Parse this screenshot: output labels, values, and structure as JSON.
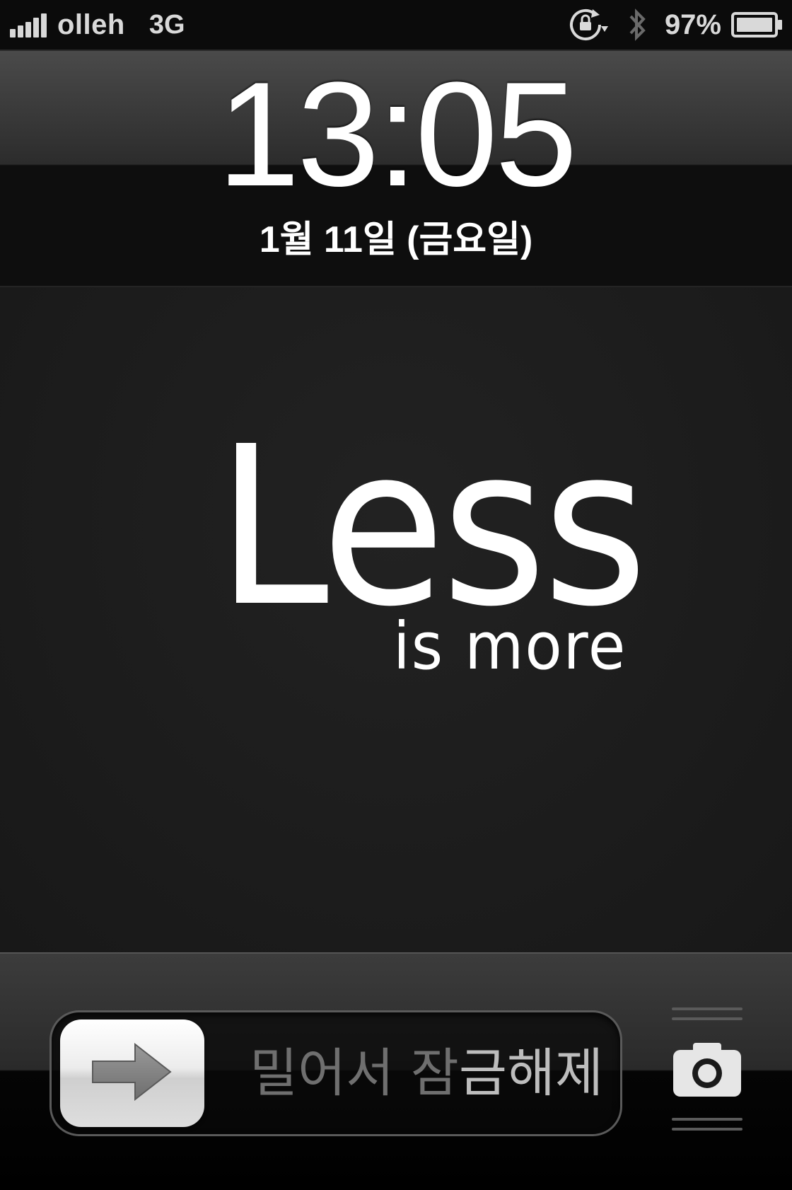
{
  "status_bar": {
    "carrier": "olleh",
    "network": "3G",
    "battery_percent": "97%",
    "signal_bars": 5,
    "icons": [
      "signal-icon",
      "rotation-lock-icon",
      "bluetooth-icon",
      "battery-icon"
    ]
  },
  "lock_screen": {
    "time": "13:05",
    "date": "1월 11일 (금요일)"
  },
  "wallpaper": {
    "headline": "Less",
    "subline": "is more"
  },
  "unlock": {
    "label_part1": "밀어서 잠",
    "label_part2": "금해제",
    "knob_icon": "right-arrow-icon",
    "camera_icon": "camera-icon"
  },
  "colors": {
    "background": "#1a1a1a",
    "text": "#ffffff",
    "status_bar": "#0b0b0b"
  }
}
